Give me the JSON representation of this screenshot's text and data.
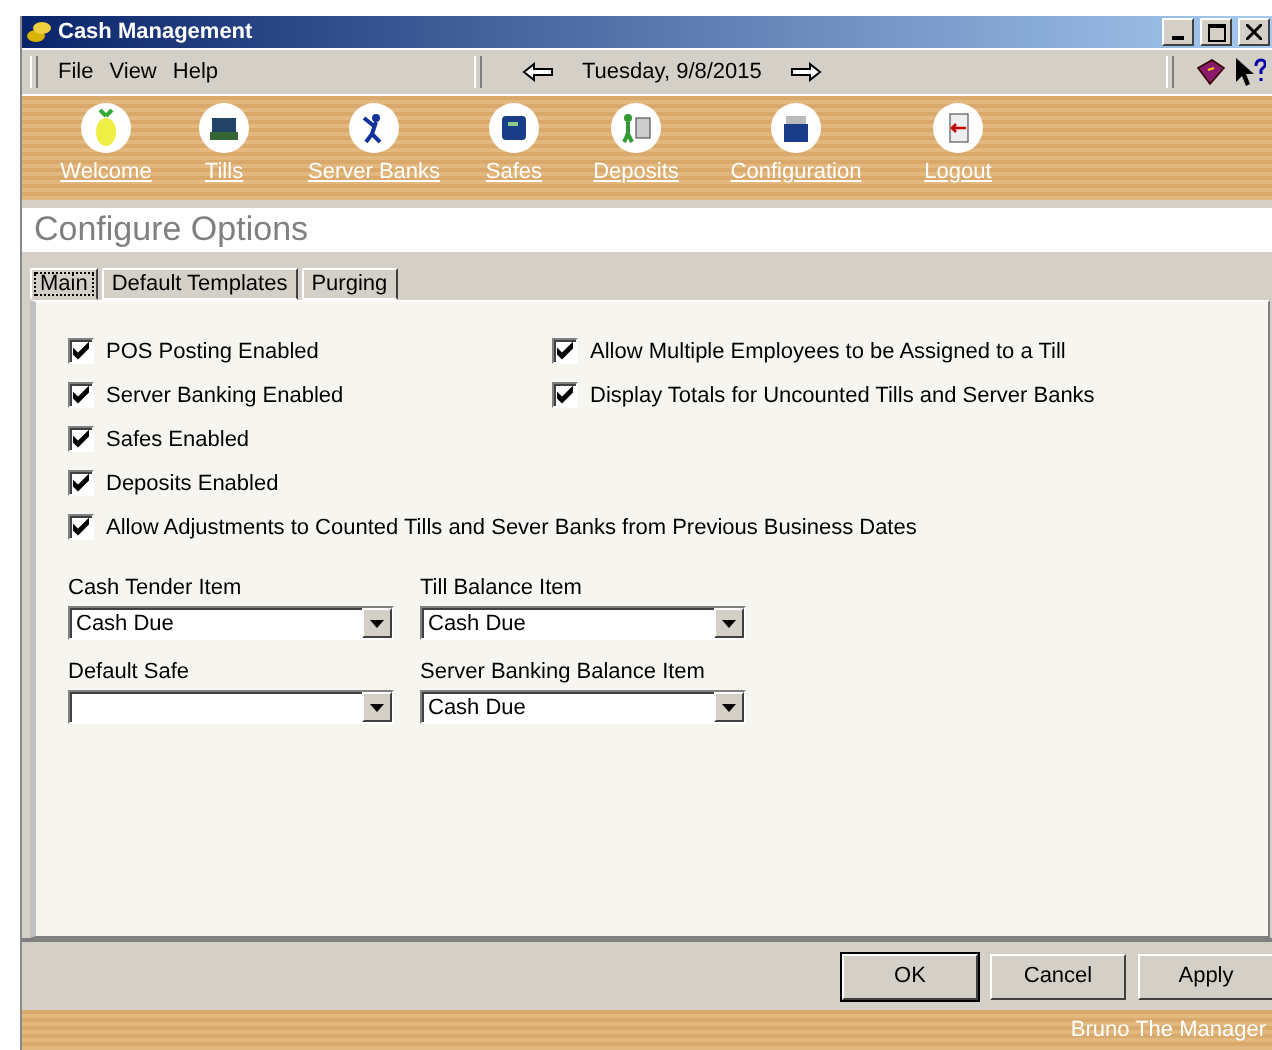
{
  "window": {
    "title": "Cash Management"
  },
  "menu": [
    "File",
    "View",
    "Help"
  ],
  "date": "Tuesday, 9/8/2015",
  "toolbar": [
    {
      "label": "Welcome",
      "kind": "welcome"
    },
    {
      "label": "Tills",
      "kind": "tills"
    },
    {
      "label": "Server Banks",
      "kind": "server"
    },
    {
      "label": "Safes",
      "kind": "safes"
    },
    {
      "label": "Deposits",
      "kind": "deposits"
    },
    {
      "label": "Configuration",
      "kind": "config"
    },
    {
      "label": "Logout",
      "kind": "logout"
    }
  ],
  "page_title": "Configure Options",
  "tabs": [
    {
      "label": "Main",
      "selected": true
    },
    {
      "label": "Default Templates",
      "selected": false
    },
    {
      "label": "Purging",
      "selected": false
    }
  ],
  "options_left": [
    {
      "label": "POS Posting Enabled",
      "checked": true
    },
    {
      "label": "Server Banking Enabled",
      "checked": true
    },
    {
      "label": "Safes Enabled",
      "checked": true
    },
    {
      "label": "Deposits Enabled",
      "checked": true
    }
  ],
  "options_right": [
    {
      "label": "Allow Multiple Employees to be Assigned to a Till",
      "checked": true
    },
    {
      "label": "Display Totals for Uncounted Tills and Server Banks",
      "checked": true
    }
  ],
  "option_wide": {
    "label": "Allow Adjustments to Counted Tills and Sever Banks from Previous Business Dates",
    "checked": true
  },
  "fields": [
    {
      "label": "Cash Tender Item",
      "value": "Cash Due"
    },
    {
      "label": "Till Balance Item",
      "value": "Cash Due"
    },
    {
      "label": "Default Safe"
    },
    {
      "label": "Server Banking Balance Item",
      "value": "Cash Due"
    }
  ],
  "buttons": [
    {
      "label": "OK",
      "default": true
    },
    {
      "label": "Cancel",
      "default": false
    },
    {
      "label": "Apply",
      "default": false
    }
  ],
  "status_bar": {
    "user": "Bruno The Manager"
  }
}
